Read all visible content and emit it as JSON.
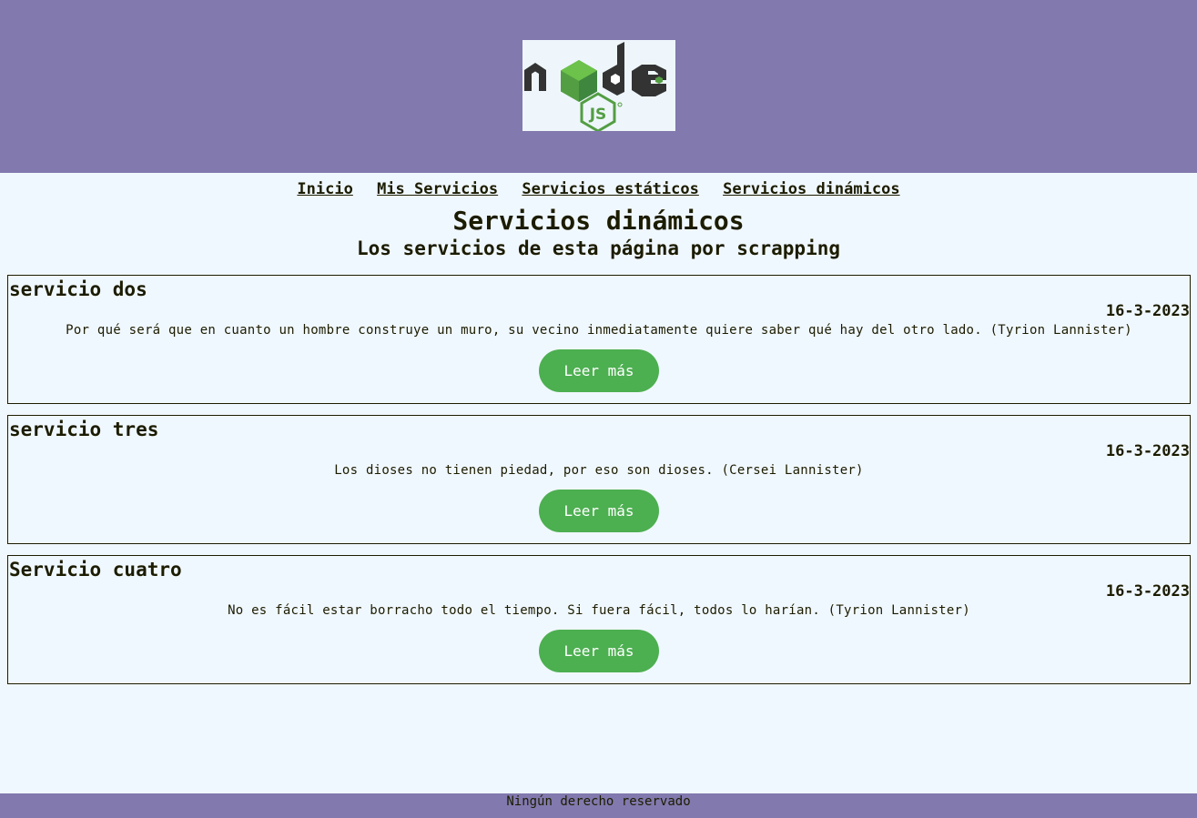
{
  "header": {
    "logo_icon": "nodejs-logo-icon"
  },
  "nav": {
    "items": [
      {
        "label": "Inicio"
      },
      {
        "label": "Mis Servicios"
      },
      {
        "label": "Servicios estáticos"
      },
      {
        "label": "Servicios dinámicos"
      }
    ]
  },
  "main": {
    "title": "Servicios dinámicos",
    "subtitle": "Los servicios de esta página por scrapping",
    "cards": [
      {
        "title": "servicio dos",
        "date": "16-3-2023",
        "text": "Por qué será que en cuanto un hombre construye un muro, su vecino inmediatamente quiere saber qué hay del otro lado. (Tyrion Lannister)",
        "button_label": "Leer más"
      },
      {
        "title": "servicio tres",
        "date": "16-3-2023",
        "text": "Los dioses no tienen piedad, por eso son dioses. (Cersei Lannister)",
        "button_label": "Leer más"
      },
      {
        "title": "Servicio cuatro",
        "date": "16-3-2023",
        "text": "No es fácil estar borracho todo el tiempo. Si fuera fácil, todos lo harían. (Tyrion Lannister)",
        "button_label": "Leer más"
      }
    ]
  },
  "footer": {
    "text": "Ningún derecho reservado"
  },
  "colors": {
    "header_bg": "#8279ae",
    "page_bg": "#f0f8ff",
    "button_bg": "#4caf50",
    "text": "#1c1c00"
  }
}
